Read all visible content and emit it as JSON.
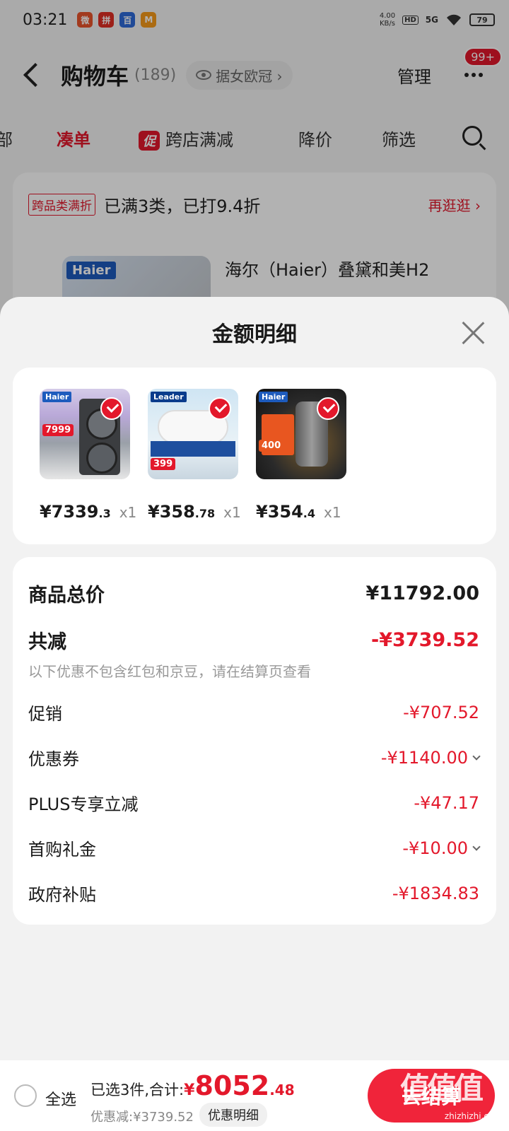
{
  "status_bar": {
    "time": "03:21",
    "net_speed_value": "4.00",
    "net_speed_unit": "KB/s",
    "hd": "HD",
    "signal": "5G",
    "battery": "79",
    "app_icons": [
      "微",
      "拼",
      "百",
      "M"
    ]
  },
  "cart_header": {
    "title": "购物车",
    "count": "(189)",
    "follow_text": "据女欧冠 ›",
    "manage_label": "管理",
    "message_badge": "99+"
  },
  "filter_bar": {
    "partial_left": "部",
    "items": [
      "凑单",
      "跨店满减",
      "降价",
      "筛选"
    ],
    "promo_tag": "促"
  },
  "cart_card": {
    "cross_tag": "跨品类满折",
    "discount_text": "已满3类，已打9.4折",
    "shop_more": "再逛逛 ›",
    "brand_logo": "Haier",
    "product_title": "海尔（Haier）叠黛和美H2"
  },
  "sheet": {
    "title": "金额明细",
    "products": [
      {
        "brand": "Haier",
        "badge_price": "7999",
        "price_int": "¥7339",
        "price_frac": ".3",
        "qty": "x1"
      },
      {
        "brand": "Leader",
        "badge_price": "399",
        "price_int": "¥358",
        "price_frac": ".78",
        "qty": "x1"
      },
      {
        "brand": "Haier",
        "badge_price": "400",
        "price_int": "¥354",
        "price_frac": ".4",
        "qty": "x1"
      }
    ],
    "totals": {
      "goods_total_label": "商品总价",
      "goods_total_value": "¥11792.00",
      "total_discount_label": "共减",
      "total_discount_value": "-¥3739.52",
      "note": "以下优惠不包含红包和京豆，请在结算页查看",
      "items": [
        {
          "label": "促销",
          "value": "-¥707.52",
          "expandable": false
        },
        {
          "label": "优惠券",
          "value": "-¥1140.00",
          "expandable": true
        },
        {
          "label": "PLUS专享立减",
          "value": "-¥47.17",
          "expandable": false
        },
        {
          "label": "首购礼金",
          "value": "-¥10.00",
          "expandable": true
        },
        {
          "label": "政府补贴",
          "value": "-¥1834.83",
          "expandable": false
        }
      ]
    }
  },
  "bottom_bar": {
    "select_all": "全选",
    "summary": "已选3件,合计:",
    "total_yen": "¥",
    "total_int": "8052",
    "total_frac": ".48",
    "saved": "优惠减:¥3739.52",
    "detail_button": "优惠明细",
    "checkout_label": "去结算"
  },
  "watermark": {
    "big": "值值值",
    "small": "zhizhizhi.com"
  },
  "colors": {
    "accent_red": "#e3182b",
    "checkout_red": "#f0243a",
    "sheet_bg": "#f2f2f2"
  }
}
